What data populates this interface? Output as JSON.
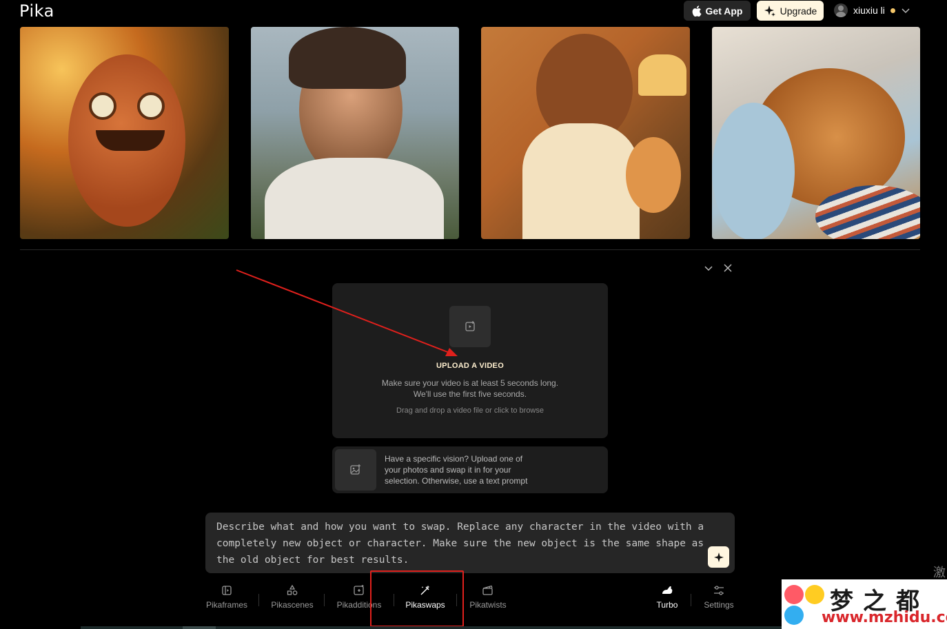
{
  "header": {
    "logo": "Pika",
    "get_app_label": "Get App",
    "upgrade_label": "Upgrade",
    "username": "xiuxiu li"
  },
  "gallery": {
    "items": [
      {
        "subject": "orange furry monster in sunny meadow"
      },
      {
        "subject": "thoughtful woman with sunglasses on head"
      },
      {
        "subject": "illustrated kid with headphones writing, with cat"
      },
      {
        "subject": "orange tabby cat sleeping on pillow"
      }
    ]
  },
  "upload": {
    "title": "UPLOAD A VIDEO",
    "desc_line1": "Make sure your video is at least 5 seconds long.",
    "desc_line2": "We'll use the first five seconds.",
    "hint": "Drag and drop a video file or click to browse"
  },
  "swap_photo": {
    "text": "Have a specific vision? Upload one of your photos and swap it in for your selection. Otherwise, use a text prompt"
  },
  "prompt": {
    "placeholder": "Describe what and how you want to swap. Replace any character in the video with a completely new object or character. Make sure the new object is the same shape as the old object for best results."
  },
  "toolbar": {
    "items": [
      {
        "label": "Pikaframes"
      },
      {
        "label": "Pikascenes"
      },
      {
        "label": "Pikadditions"
      },
      {
        "label": "Pikaswaps"
      },
      {
        "label": "Pikatwists"
      }
    ],
    "turbo_label": "Turbo",
    "settings_label": "Settings"
  },
  "watermark": {
    "brand_cn": "梦之都",
    "url": "www.mzhidu.com",
    "side_char": "激"
  },
  "colors": {
    "background": "#000000",
    "accent_cream": "#fff6e0",
    "annotation_red": "#e0201c"
  }
}
